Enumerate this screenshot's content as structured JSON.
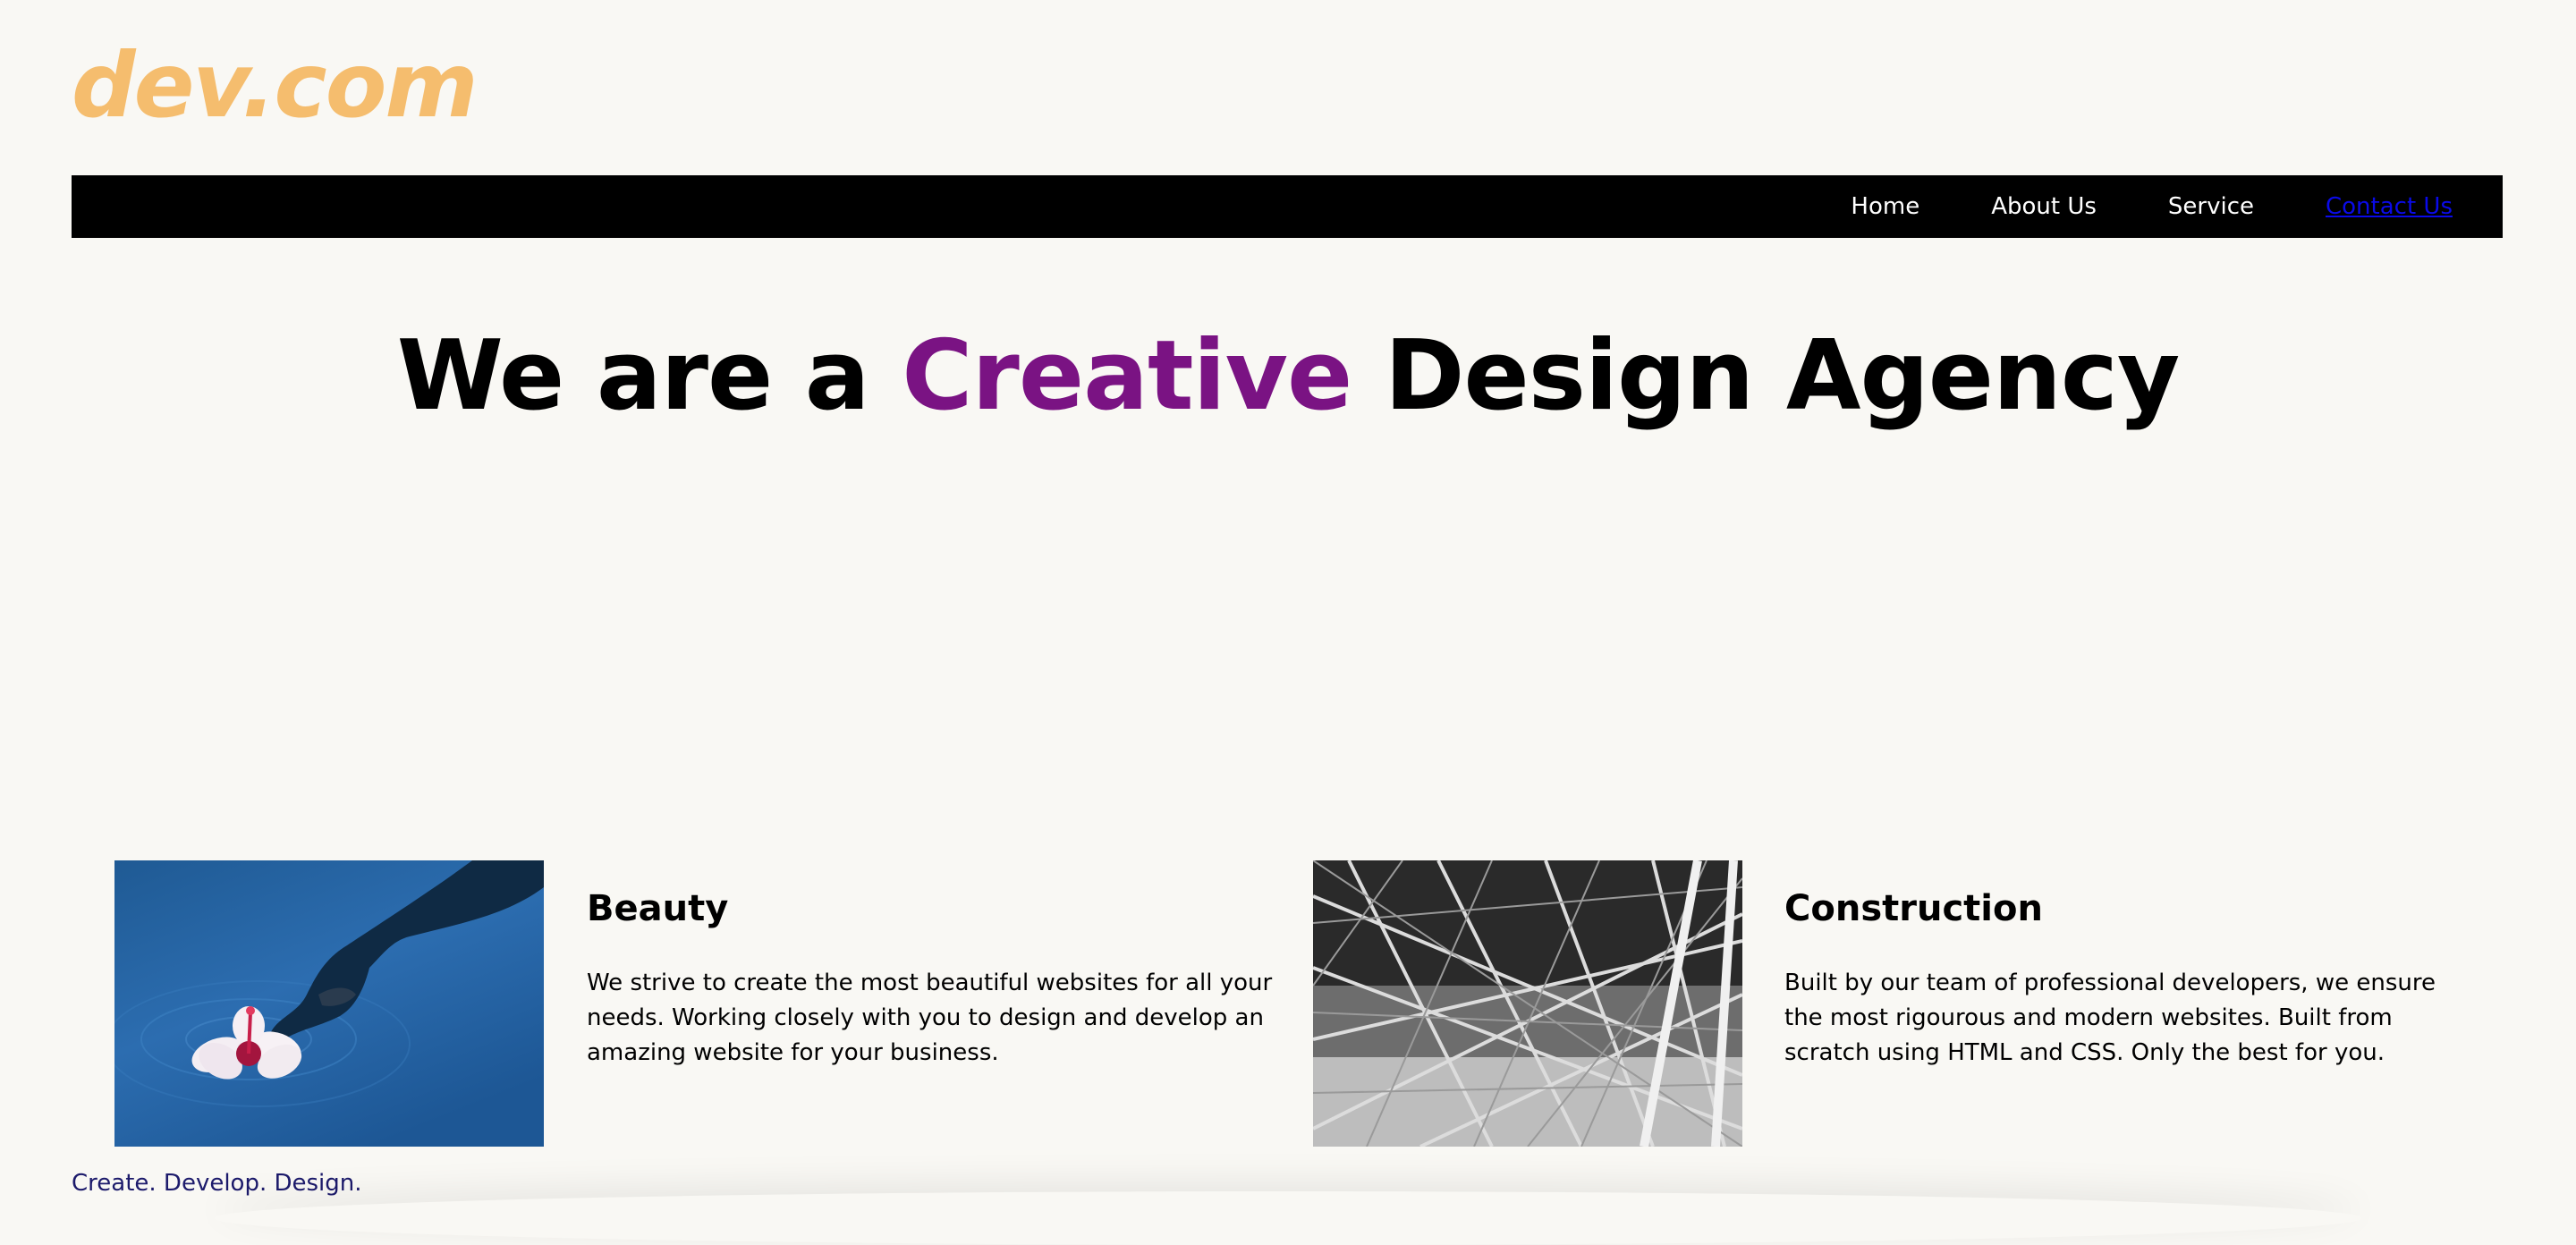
{
  "brand": {
    "logo": "dev.com",
    "logo_color": "#f5bd6e"
  },
  "nav": {
    "items": [
      {
        "label": "Home"
      },
      {
        "label": "About Us"
      },
      {
        "label": "Service"
      },
      {
        "label": "Contact Us",
        "active": true
      }
    ]
  },
  "hero": {
    "before": "We are a",
    "highlight": "Creative",
    "after": "Design Agency",
    "accent_color": "#7a1383"
  },
  "features": [
    {
      "title": "Beauty",
      "text": "We strive to create the most beautiful websites for all your needs. Working closely with you to design and develop an amazing website for your business."
    },
    {
      "title": "Construction",
      "text": "Built by our team of professional developers, we ensure the most rigourous and modern websites. Built from scratch using HTML and CSS. Only the best for you."
    }
  ],
  "footer": {
    "tagline": "Create. Develop. Design."
  }
}
